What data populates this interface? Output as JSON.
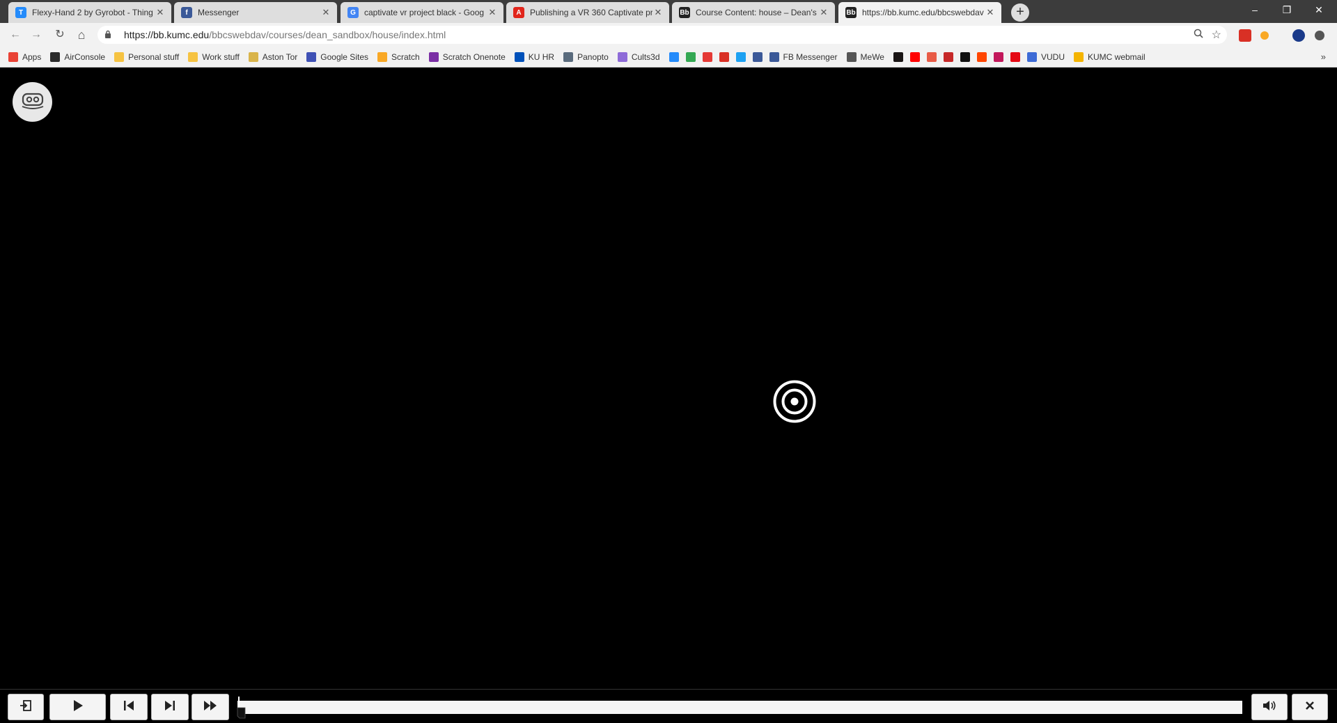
{
  "browser": {
    "tabs": [
      {
        "title": "Flexy-Hand 2 by Gyrobot - Thing",
        "icon": "thingiverse-icon",
        "color": "#248bfb",
        "glyph": "T",
        "active": false
      },
      {
        "title": "Messenger",
        "icon": "facebook-icon",
        "color": "#3b5998",
        "glyph": "f",
        "active": false
      },
      {
        "title": "captivate vr project black - Goog",
        "icon": "google-icon",
        "color": "#4285f4",
        "glyph": "G",
        "active": false
      },
      {
        "title": "Publishing a VR 360 Captivate pr",
        "icon": "adobe-icon",
        "color": "#e1251b",
        "glyph": "A",
        "active": false
      },
      {
        "title": "Course Content: house – Dean's",
        "icon": "blackboard-icon",
        "color": "#222222",
        "glyph": "Bb",
        "active": false
      },
      {
        "title": "https://bb.kumc.edu/bbcswebdav",
        "icon": "blackboard-icon",
        "color": "#222222",
        "glyph": "Bb",
        "active": true
      }
    ],
    "tab_close_glyph": "✕",
    "new_tab_glyph": "+",
    "window_controls": {
      "minimize": "–",
      "restore": "❐",
      "close": "✕"
    },
    "nav": {
      "back": "←",
      "forward": "→",
      "reload": "↻",
      "home": "⌂"
    },
    "url_host": "https://bb.kumc.edu",
    "url_path": "/bbcswebdav/courses/dean_sandbox/house/index.html",
    "bookmarks": [
      {
        "label": "Apps",
        "icon": "apps-grid-icon",
        "color": "#e94235"
      },
      {
        "label": "AirConsole",
        "icon": "airconsole-icon",
        "color": "#2b2b2b"
      },
      {
        "label": "Personal stuff",
        "icon": "folder-icon",
        "color": "#f6c342"
      },
      {
        "label": "Work stuff",
        "icon": "folder-icon",
        "color": "#f6c342"
      },
      {
        "label": "Aston Tor",
        "icon": "aston-tor-icon",
        "color": "#d9b44a"
      },
      {
        "label": "Google Sites",
        "icon": "google-sites-icon",
        "color": "#3f51b5"
      },
      {
        "label": "Scratch",
        "icon": "scratch-icon",
        "color": "#f9a825"
      },
      {
        "label": "Scratch Onenote",
        "icon": "onenote-icon",
        "color": "#7b2fa5"
      },
      {
        "label": "KU HR",
        "icon": "ku-icon",
        "color": "#0051ba"
      },
      {
        "label": "Panopto",
        "icon": "ku-icon",
        "color": "#5a6b7d"
      },
      {
        "label": "Cults3d",
        "icon": "cults3d-icon",
        "color": "#8e6bd8"
      },
      {
        "label": "",
        "icon": "thingiverse-icon",
        "color": "#248bfb"
      },
      {
        "label": "",
        "icon": "colorful-grid-icon",
        "color": "#34a853"
      },
      {
        "label": "",
        "icon": "red-app-icon",
        "color": "#e53935"
      },
      {
        "label": "",
        "icon": "gmail-icon",
        "color": "#d93025"
      },
      {
        "label": "",
        "icon": "twitter-icon",
        "color": "#1da1f2"
      },
      {
        "label": "",
        "icon": "facebook-icon",
        "color": "#3b5998"
      },
      {
        "label": "FB Messenger",
        "icon": "facebook-icon",
        "color": "#3b5998"
      },
      {
        "label": "MeWe",
        "icon": "mewe-icon",
        "color": "#555555"
      },
      {
        "label": "",
        "icon": "spotify-icon",
        "color": "#191414"
      },
      {
        "label": "",
        "icon": "youtube-icon",
        "color": "#ff0000"
      },
      {
        "label": "",
        "icon": "patreon-icon",
        "color": "#e85b46"
      },
      {
        "label": "",
        "icon": "red-v-icon",
        "color": "#c62828"
      },
      {
        "label": "",
        "icon": "digg-icon",
        "color": "#111111"
      },
      {
        "label": "",
        "icon": "reddit-icon",
        "color": "#ff4500"
      },
      {
        "label": "",
        "icon": "shield-icon",
        "color": "#c2185b"
      },
      {
        "label": "",
        "icon": "netflix-icon",
        "color": "#e50914"
      },
      {
        "label": "VUDU",
        "icon": "vudu-icon",
        "color": "#3d6bd6"
      },
      {
        "label": "KUMC webmail",
        "icon": "outlook-icon",
        "color": "#f4b400"
      }
    ],
    "bookmarks_more": "»"
  },
  "player": {
    "progress_fraction": 0.0
  },
  "colors": {
    "background": "#000000",
    "chrome_dark": "#3c3c3c",
    "chrome_light": "#f2f2f2",
    "playbar_button": "#f4f4f4"
  }
}
